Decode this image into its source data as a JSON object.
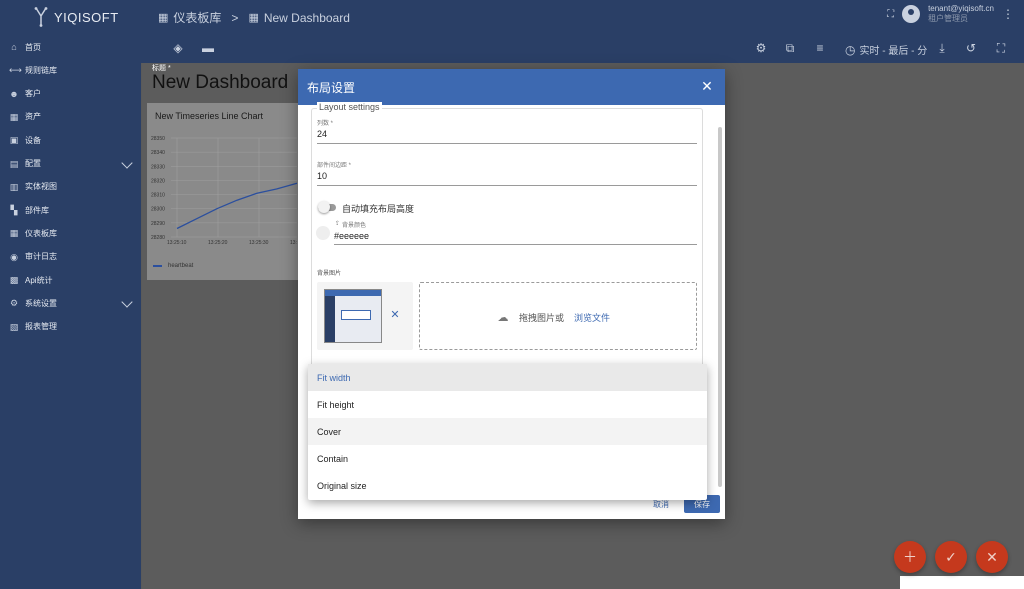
{
  "app": {
    "brand": "YIQISOFT"
  },
  "breadcrumb": {
    "items": [
      {
        "label": "仪表板库"
      },
      {
        "label": "New Dashboard"
      }
    ],
    "separator": ">"
  },
  "user": {
    "email": "tenant@yiqisoft.cn",
    "role": "租户管理员"
  },
  "toolbar": {
    "realtime_label": "实时 - 最后 - 分"
  },
  "sidebar": {
    "items": [
      {
        "label": "首页",
        "icon": "home-icon",
        "glyph": "⌂"
      },
      {
        "label": "规则链库",
        "icon": "rule-chain-icon",
        "glyph": "⟷"
      },
      {
        "label": "客户",
        "icon": "customers-icon",
        "glyph": "☻"
      },
      {
        "label": "资产",
        "icon": "assets-icon",
        "glyph": "▦"
      },
      {
        "label": "设备",
        "icon": "devices-icon",
        "glyph": "▣"
      },
      {
        "label": "配置",
        "icon": "profiles-icon",
        "glyph": "▤",
        "expandable": true
      },
      {
        "label": "实体视图",
        "icon": "entity-view-icon",
        "glyph": "▥"
      },
      {
        "label": "部件库",
        "icon": "widgets-icon",
        "glyph": "▚"
      },
      {
        "label": "仪表板库",
        "icon": "dashboards-icon",
        "glyph": "▦"
      },
      {
        "label": "审计日志",
        "icon": "audit-log-icon",
        "glyph": "◉"
      },
      {
        "label": "Api统计",
        "icon": "api-stats-icon",
        "glyph": "▩"
      },
      {
        "label": "系统设置",
        "icon": "settings-icon",
        "glyph": "⚙",
        "expandable": true
      },
      {
        "label": "报表管理",
        "icon": "reports-icon",
        "glyph": "▧"
      }
    ]
  },
  "dashboard": {
    "title_label": "标题 *",
    "title": "New Dashboard"
  },
  "widget": {
    "title": "New Timeseries Line Chart",
    "legend": "heartbeat"
  },
  "chart_data": {
    "type": "line",
    "series": [
      {
        "name": "heartbeat",
        "color": "#2b4f9e",
        "x": [
          "13:25:10",
          "13:25:15",
          "13:25:20",
          "13:25:25",
          "13:25:30",
          "13:25:35",
          "13:25:40"
        ],
        "values": [
          28286,
          28293,
          28300,
          28306,
          28311,
          28314,
          28318
        ]
      }
    ],
    "yticks": [
      "28350",
      "28340",
      "28330",
      "28320",
      "28310",
      "28300",
      "28290",
      "28280"
    ],
    "xticks": [
      "13:25:10",
      "13:25:20",
      "13:25:30",
      "13:"
    ],
    "ylim": [
      28280,
      28350
    ],
    "grid": true
  },
  "dialog": {
    "title": "布局设置",
    "legend": "Layout settings",
    "columns_label": "列数 *",
    "columns_value": "24",
    "margin_label": "部件间边距 *",
    "margin_value": "10",
    "autofill_label": "自动填充布局高度",
    "bg_color_label": "背景颜色",
    "bg_color_value": "#eeeeee",
    "bg_image_label": "背景图片",
    "drop_text": "拖拽图片或",
    "browse_link": "浏览文件",
    "cancel": "取消",
    "save": "保存"
  },
  "dropdown": {
    "options": [
      "Fit width",
      "Fit height",
      "Cover",
      "Contain",
      "Original size"
    ],
    "selected": "Fit width"
  },
  "colors": {
    "header": "#2a3f66",
    "dialog_header": "#3d69b1",
    "fab": "#c5391d"
  }
}
